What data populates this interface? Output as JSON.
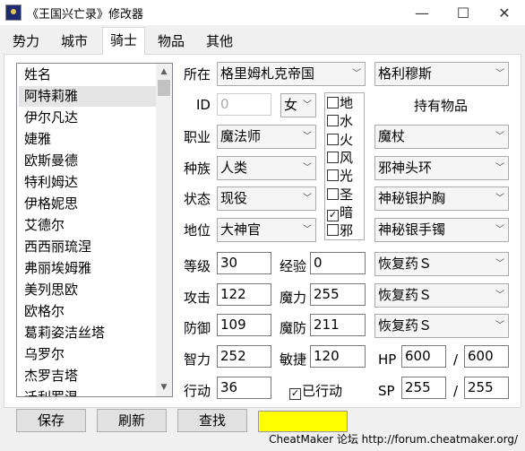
{
  "window": {
    "title": "《王国兴亡录》修改器",
    "minimize": "—",
    "maximize": "☐",
    "close": "✕"
  },
  "tabs": [
    "势力",
    "城市",
    "骑士",
    "物品",
    "其他"
  ],
  "list": {
    "items": [
      "姓名",
      "阿特莉雅",
      "伊尔凡达",
      "婕雅",
      "欧斯曼德",
      "特利姆达",
      "伊格妮思",
      "艾德尔",
      "西西丽琉涅",
      "弗丽埃姆雅",
      "美列思欧",
      "欧格尔",
      "葛莉姿洁丝塔",
      "乌罗尔",
      "杰罗吉塔",
      "迁利罗温"
    ],
    "selected_index": 1,
    "scroll_up": "▲",
    "scroll_down": "▼"
  },
  "form": {
    "location_label": "所在",
    "location_value": "格里姆札克帝国",
    "location_city": "格利穆斯",
    "id_label": "ID",
    "id_value": "0",
    "gender": "女",
    "job_label": "职业",
    "job_value": "魔法师",
    "race_label": "种族",
    "race_value": "人类",
    "state_label": "状态",
    "state_value": "现役",
    "rank_label": "地位",
    "rank_value": "大神官",
    "items_heading": "持有物品",
    "items": [
      "魔杖",
      "邪神头环",
      "神秘银护胸",
      "神秘银手镯",
      "恢复药Ｓ",
      "恢复药Ｓ",
      "恢复药Ｓ"
    ],
    "elements": [
      {
        "label": "地",
        "checked": false
      },
      {
        "label": "水",
        "checked": false
      },
      {
        "label": "火",
        "checked": false
      },
      {
        "label": "风",
        "checked": false
      },
      {
        "label": "光",
        "checked": false
      },
      {
        "label": "圣",
        "checked": false
      },
      {
        "label": "暗",
        "checked": true
      },
      {
        "label": "邪",
        "checked": false
      }
    ],
    "stats": {
      "level_label": "等级",
      "level": "30",
      "exp_label": "经验",
      "exp": "0",
      "atk_label": "攻击",
      "atk": "122",
      "mag_label": "魔力",
      "mag": "255",
      "def_label": "防御",
      "def": "109",
      "mdef_label": "魔防",
      "mdef": "211",
      "int_label": "智力",
      "int": "252",
      "agi_label": "敏捷",
      "agi": "120",
      "move_label": "行动",
      "move": "36",
      "acted_label": "已行动",
      "acted": true,
      "hp_label": "HP",
      "hp": "600",
      "hp_max": "600",
      "sp_label": "SP",
      "sp": "255",
      "sp_max": "255",
      "slash": "/"
    }
  },
  "buttons": {
    "save": "保存",
    "refresh": "刷新",
    "find": "查找"
  },
  "status_color": "#ffff00",
  "footer": "CheatMaker 论坛 http://forum.cheatmaker.org/"
}
